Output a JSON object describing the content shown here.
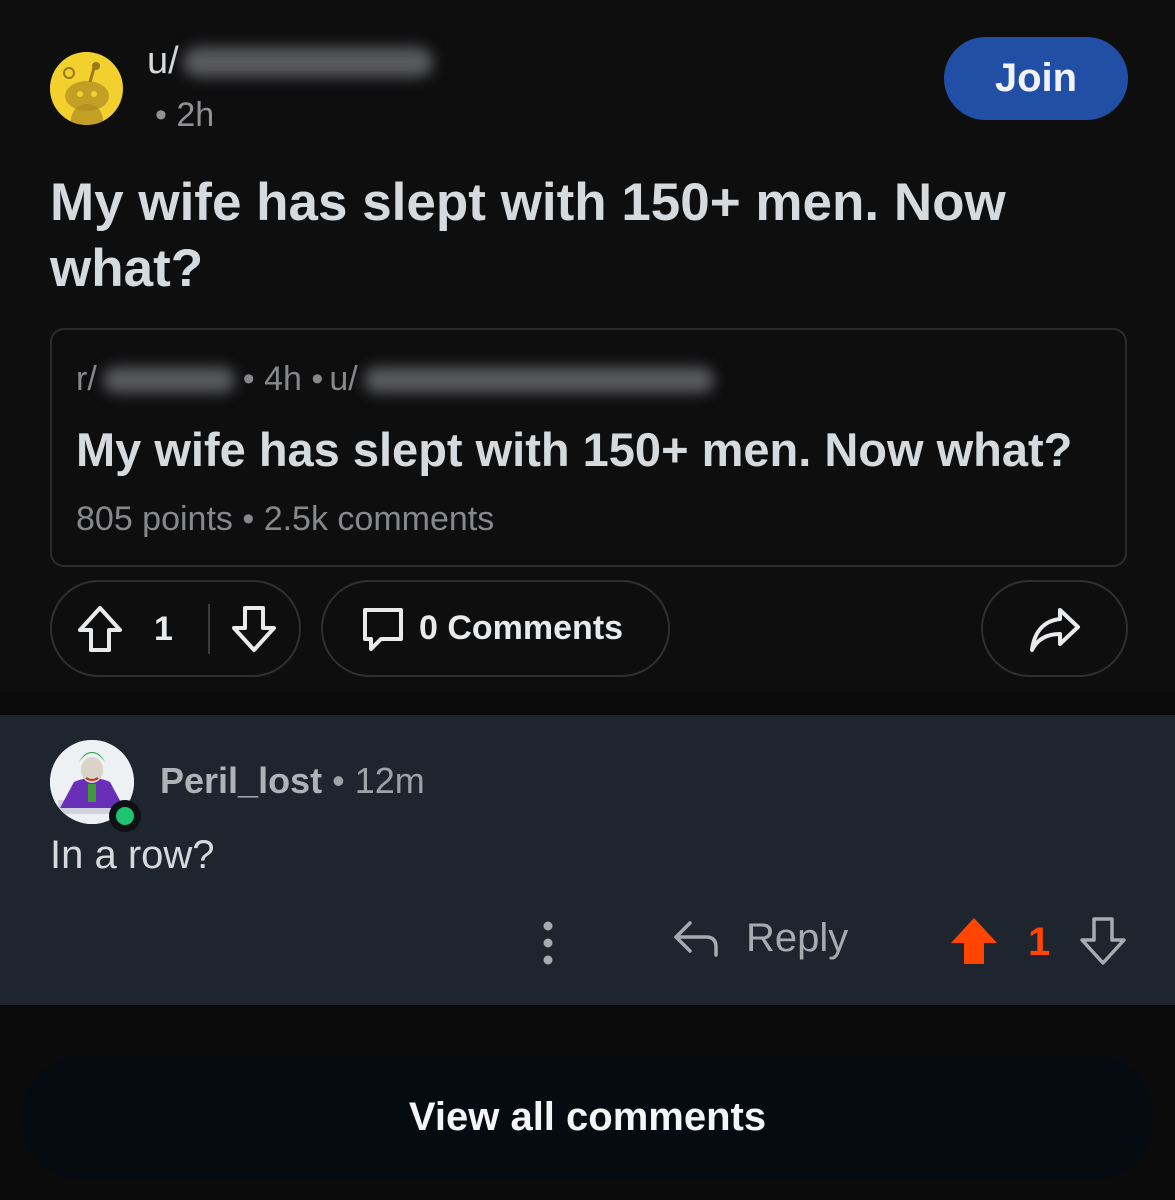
{
  "post": {
    "author_prefix": "u/",
    "time": "• 2h",
    "join_label": "Join",
    "title": "My wife has slept with 150+ men. Now what?",
    "crosspost": {
      "sub_prefix": "r/",
      "time": "• 4h •",
      "user_prefix": "u/",
      "title": "My wife has slept with 150+ men. Now what?",
      "stats": "805 points • 2.5k comments"
    },
    "vote_count": "1",
    "comments_label": "0 Comments"
  },
  "comment": {
    "author": "Peril_lost",
    "time": "• 12m",
    "body": "In a row?",
    "reply_label": "Reply",
    "score": "1"
  },
  "footer": {
    "view_all_label": "View all comments"
  },
  "colors": {
    "join_button": "#224fa6",
    "upvote_active": "#ff4500",
    "online": "#1fc470",
    "comment_bg": "#1f252e"
  },
  "icons": [
    "snoo-avatar-icon",
    "upvote-icon",
    "downvote-icon",
    "comment-icon",
    "share-icon",
    "more-icon",
    "reply-icon"
  ]
}
